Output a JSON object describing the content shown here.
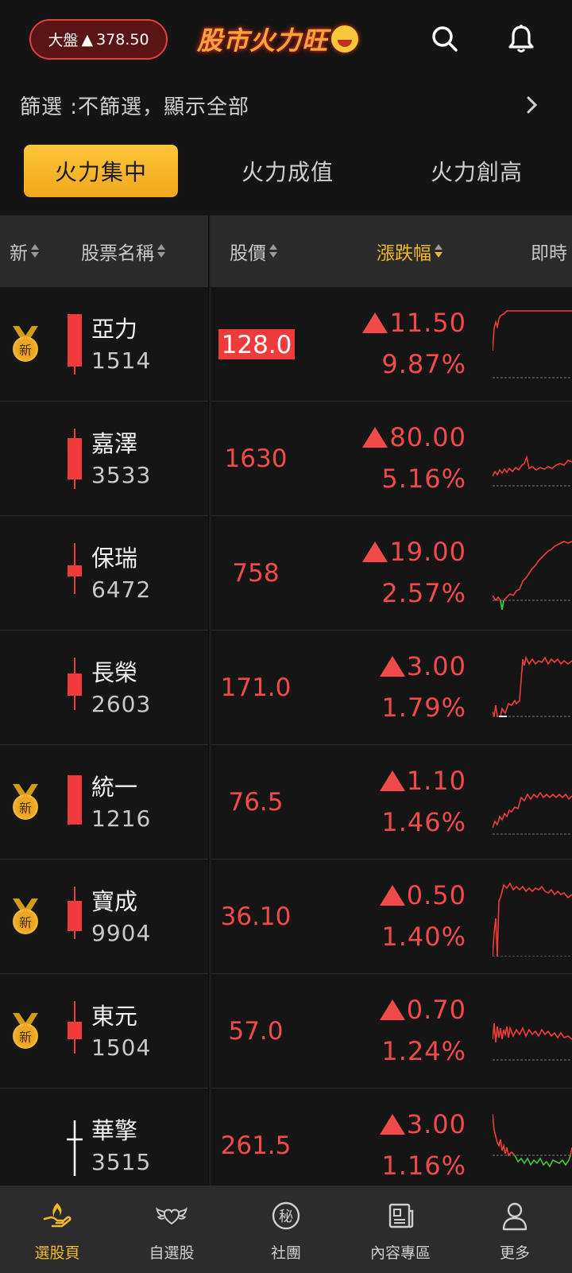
{
  "header": {
    "market_label": "大盤",
    "market_arrow": "▲",
    "market_value": "378.50",
    "brand": "股市火力旺",
    "search_icon": "search-icon",
    "bell_icon": "bell-icon"
  },
  "filter": {
    "text": "篩選 :不篩選，顯示全部"
  },
  "tabs": [
    {
      "label": "火力集中",
      "active": true
    },
    {
      "label": "火力成值",
      "active": false
    },
    {
      "label": "火力創高",
      "active": false
    }
  ],
  "columns": {
    "new": "新",
    "name": "股票名稱",
    "price": "股價",
    "change": "漲跌幅",
    "realtime": "即時"
  },
  "badge_text": "新",
  "colors": {
    "up": "#f04a4a",
    "down": "#3ec43e",
    "accent": "#f3b72c"
  },
  "rows": [
    {
      "name": "亞力",
      "code": "1514",
      "price": "128.0",
      "change": "11.50",
      "pct": "9.87%",
      "is_new": true,
      "highlight": true
    },
    {
      "name": "嘉澤",
      "code": "3533",
      "price": "1630",
      "change": "80.00",
      "pct": "5.16%",
      "is_new": false,
      "highlight": false
    },
    {
      "name": "保瑞",
      "code": "6472",
      "price": "758",
      "change": "19.00",
      "pct": "2.57%",
      "is_new": false,
      "highlight": false
    },
    {
      "name": "長榮",
      "code": "2603",
      "price": "171.0",
      "change": "3.00",
      "pct": "1.79%",
      "is_new": false,
      "highlight": false
    },
    {
      "name": "統一",
      "code": "1216",
      "price": "76.5",
      "change": "1.10",
      "pct": "1.46%",
      "is_new": true,
      "highlight": false
    },
    {
      "name": "寶成",
      "code": "9904",
      "price": "36.10",
      "change": "0.50",
      "pct": "1.40%",
      "is_new": true,
      "highlight": false
    },
    {
      "name": "東元",
      "code": "1504",
      "price": "57.0",
      "change": "0.70",
      "pct": "1.24%",
      "is_new": true,
      "highlight": false
    },
    {
      "name": "華擎",
      "code": "3515",
      "price": "261.5",
      "change": "3.00",
      "pct": "1.16%",
      "is_new": false,
      "highlight": false
    }
  ],
  "nav": [
    {
      "label": "選股頁",
      "icon": "fire-hand-icon",
      "active": true
    },
    {
      "label": "自選股",
      "icon": "winged-heart-icon",
      "active": false
    },
    {
      "label": "社團",
      "icon": "secret-badge-icon",
      "active": false
    },
    {
      "label": "內容專區",
      "icon": "newspaper-icon",
      "active": false
    },
    {
      "label": "更多",
      "icon": "person-icon",
      "active": false
    }
  ]
}
